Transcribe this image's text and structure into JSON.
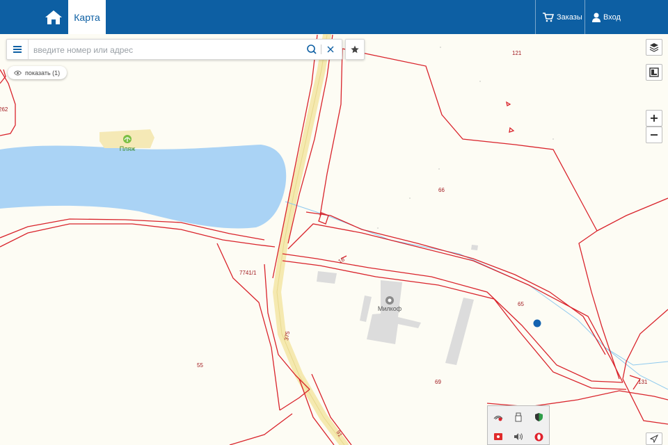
{
  "header": {
    "map_tab_label": "Карта",
    "orders_label": "Заказы",
    "login_label": "Вход"
  },
  "search": {
    "placeholder": "введите номер или адрес",
    "value": ""
  },
  "filter": {
    "show_label": "показать (1)"
  },
  "map": {
    "poi": [
      {
        "name": "Пляж",
        "icon": "beach-icon"
      },
      {
        "name": "Милкоф",
        "icon": "company-icon"
      }
    ],
    "parcel_labels": [
      "121",
      "262",
      "66",
      "7741/1",
      "65",
      "55",
      "69",
      "131",
      "375",
      "18",
      "91"
    ],
    "colors": {
      "parcel_border": "#d9232b",
      "water": "#aad3f5",
      "road": "#f5e9b0",
      "building": "#dedede",
      "background": "#fdfcf4",
      "header": "#0d5fa3",
      "marker": "#1463b0"
    }
  },
  "controls": [
    "layers-icon",
    "basemap-icon",
    "zoom-in-icon",
    "zoom-out-icon",
    "locate-icon"
  ],
  "tray_icons": [
    "network-icon",
    "usb-icon",
    "security-icon",
    "app-icon",
    "volume-icon",
    "opera-icon"
  ]
}
